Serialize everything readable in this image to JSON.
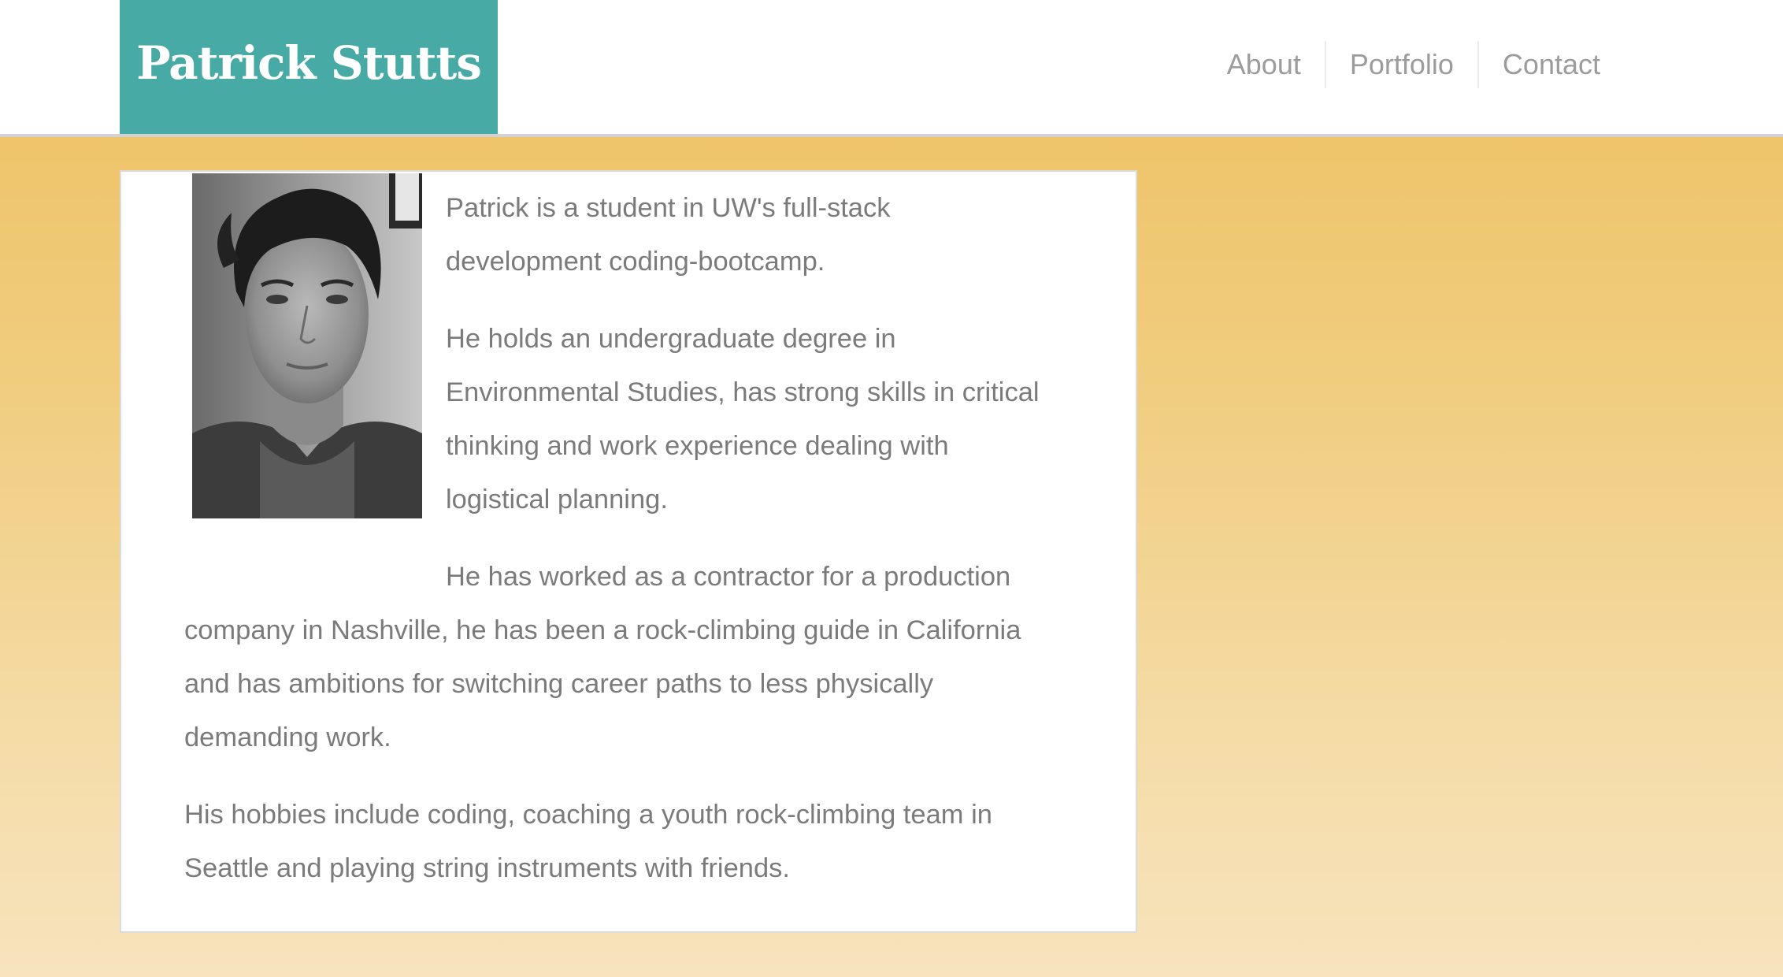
{
  "header": {
    "brand": "Patrick Stutts",
    "nav": [
      "About",
      "Portfolio",
      "Contact"
    ]
  },
  "about": {
    "photo_alt": "portrait-photo",
    "paragraphs": [
      {
        "lines": [
          "Patrick is a student in UW's full-stack",
          "development coding-bootcamp."
        ]
      },
      {
        "lines": [
          "He holds an undergraduate degree in",
          "Environmental Studies, has strong skills in critical",
          "thinking and work experience dealing with",
          "logistical planning."
        ]
      },
      {
        "lines": [
          "He has worked as a contractor for a production",
          "company in Nashville, he has been a rock-climbing guide in California",
          "and has ambitions for switching career paths to less physically",
          "demanding work."
        ]
      },
      {
        "lines": [
          "His hobbies include coding, coaching a youth rock-climbing team in",
          "Seattle and playing string instruments with friends."
        ]
      }
    ]
  },
  "colors": {
    "brand_teal": "#47aaa5",
    "background_gold": "#eec05f",
    "text_gray": "#7b7b7b",
    "nav_gray": "#9c9c9c"
  }
}
